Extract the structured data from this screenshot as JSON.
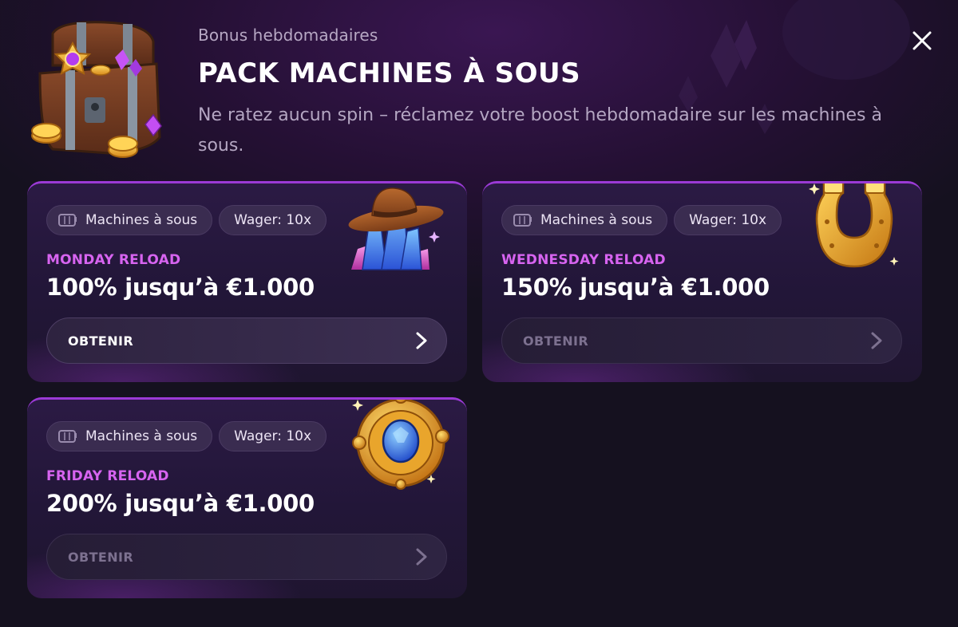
{
  "header": {
    "kicker": "Bonus hebdomadaires",
    "title": "PACK MACHINES À SOUS",
    "subtitle": "Ne ratez aucun spin – réclamez votre boost hebdomadaire sur les machines à sous."
  },
  "colors": {
    "accent": "#d764f0",
    "card_border": "#9b3ad6",
    "background": "#14101d"
  },
  "cards": [
    {
      "category_tag": "Machines à sous",
      "category_icon": "slot-machine-icon",
      "wager_tag": "Wager: 10x",
      "name": "MONDAY RELOAD",
      "amount": "100% jusqu’à €1.000",
      "cta": "OBTENIR",
      "cta_enabled": true,
      "art": "cowboy-hat-crystals-icon"
    },
    {
      "category_tag": "Machines à sous",
      "category_icon": "slot-machine-icon",
      "wager_tag": "Wager: 10x",
      "name": "WEDNESDAY RELOAD",
      "amount": "150% jusqu’à €1.000",
      "cta": "OBTENIR",
      "cta_enabled": false,
      "art": "horseshoe-icon"
    },
    {
      "category_tag": "Machines à sous",
      "category_icon": "slot-machine-icon",
      "wager_tag": "Wager: 10x",
      "name": "FRIDAY RELOAD",
      "amount": "200% jusqu’à €1.000",
      "cta": "OBTENIR",
      "cta_enabled": false,
      "art": "gem-medallion-icon"
    }
  ]
}
